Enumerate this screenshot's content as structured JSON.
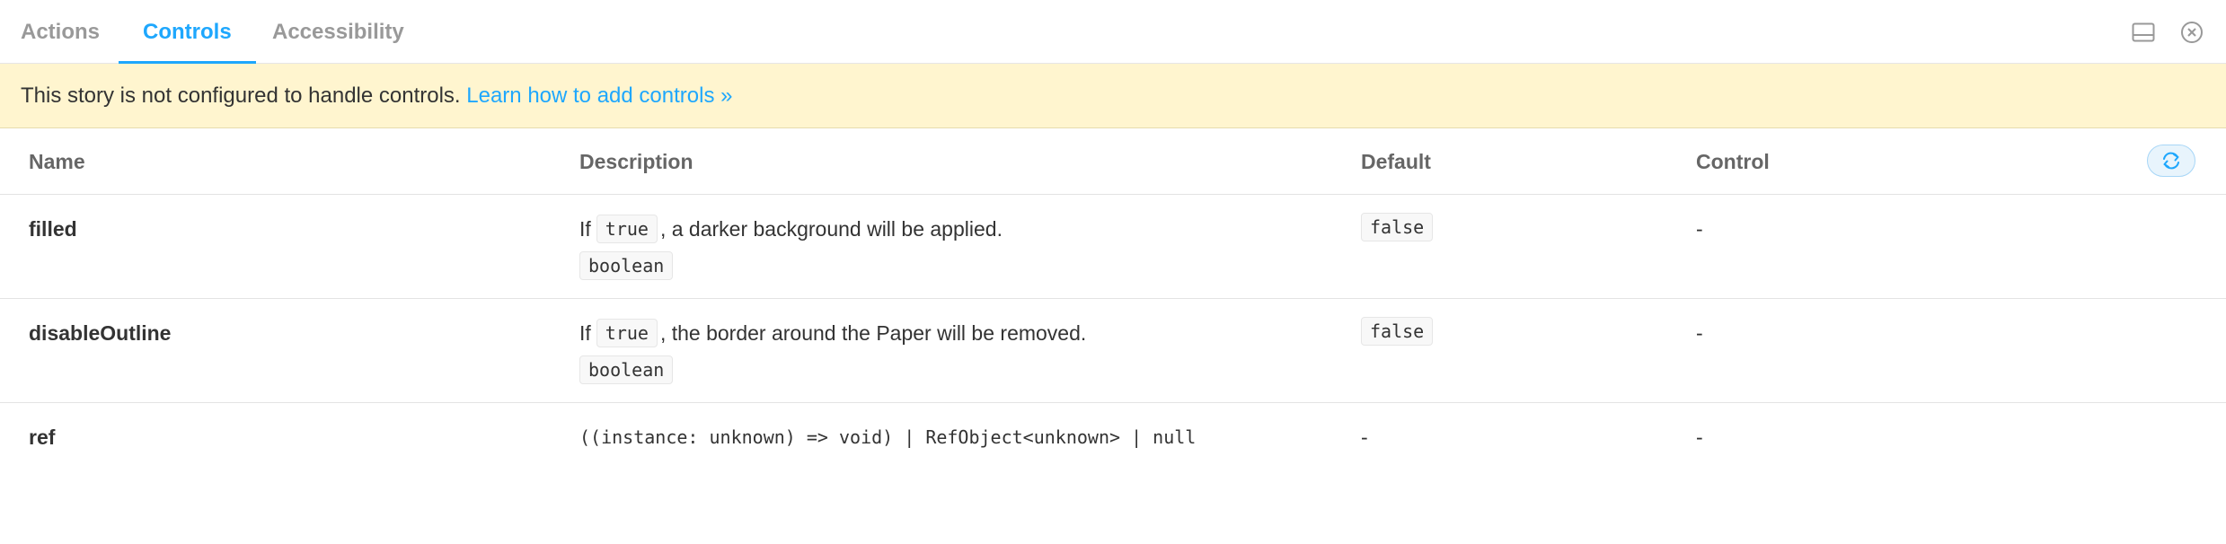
{
  "tabs": [
    {
      "label": "Actions",
      "active": false
    },
    {
      "label": "Controls",
      "active": true
    },
    {
      "label": "Accessibility",
      "active": false
    }
  ],
  "toolbar": {
    "orientation_icon": "panel-bottom-icon",
    "close_icon": "close-circle-icon"
  },
  "banner": {
    "message": "This story is not configured to handle controls.",
    "link_text": "Learn how to add controls »"
  },
  "table": {
    "headers": {
      "name": "Name",
      "description": "Description",
      "default": "Default",
      "control": "Control"
    },
    "reset_icon": "sync-icon",
    "rows": [
      {
        "name": "filled",
        "desc_prefix": "If",
        "desc_code": "true",
        "desc_suffix": ", a darker background will be applied.",
        "type": "boolean",
        "default": "false",
        "control": "-"
      },
      {
        "name": "disableOutline",
        "desc_prefix": "If",
        "desc_code": "true",
        "desc_suffix": ", the border around the Paper will be removed.",
        "type": "boolean",
        "default": "false",
        "control": "-"
      },
      {
        "name": "ref",
        "type_signature": "((instance: unknown) => void) | RefObject<unknown> | null",
        "default": "-",
        "control": "-"
      }
    ]
  },
  "colors": {
    "accent": "#1ea7fd",
    "banner_bg": "#fff5cf",
    "text": "#333333",
    "muted": "#999999"
  }
}
